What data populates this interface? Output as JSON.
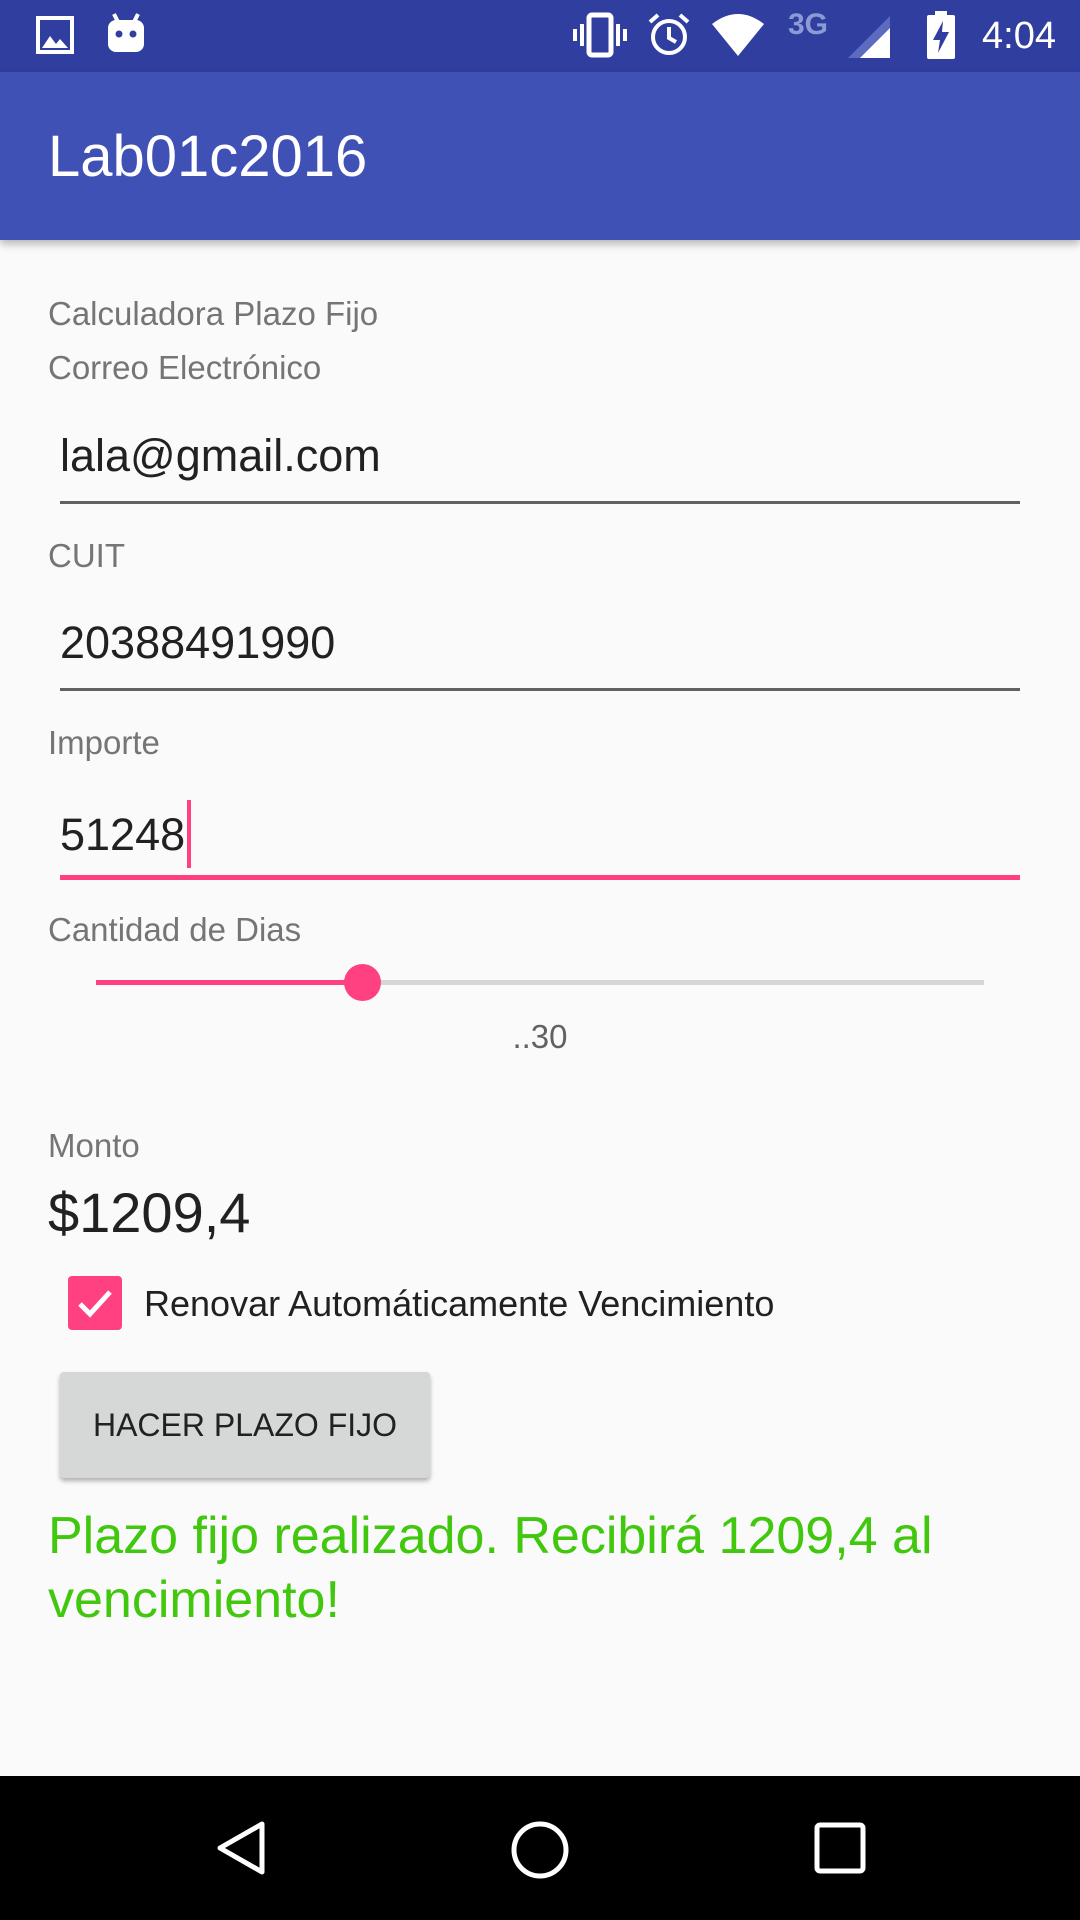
{
  "status_bar": {
    "time": "4:04",
    "network_type": "3G",
    "icons": [
      "image-icon",
      "android-icon",
      "vibrate-icon",
      "alarm-icon",
      "wifi-icon",
      "signal-icon",
      "battery-charging-icon"
    ]
  },
  "app_bar": {
    "title": "Lab01c2016"
  },
  "form": {
    "heading": "Calculadora Plazo Fijo",
    "email_label": "Correo Electrónico",
    "email_value": "lala@gmail.com",
    "cuit_label": "CUIT",
    "cuit_value": "20388491990",
    "importe_label": "Importe",
    "importe_value": "51248",
    "dias_label": "Cantidad de Dias",
    "dias_seek_fraction": 0.3,
    "dias_caption": "..30",
    "monto_label": "Monto",
    "monto_value": "$1209,4",
    "renovar_label": "Renovar Automáticamente Vencimiento",
    "renovar_checked": true,
    "submit_label": "HACER PLAZO FIJO",
    "result_text": "Plazo fijo realizado. Recibirá 1209,4 al vencimiento!"
  },
  "colors": {
    "status_bar": "#303f9f",
    "app_bar": "#3f51b5",
    "accent": "#ff4081",
    "result_text": "#41c70e"
  },
  "nav_bar": {
    "buttons": [
      "back-icon",
      "home-icon",
      "recents-icon"
    ]
  }
}
